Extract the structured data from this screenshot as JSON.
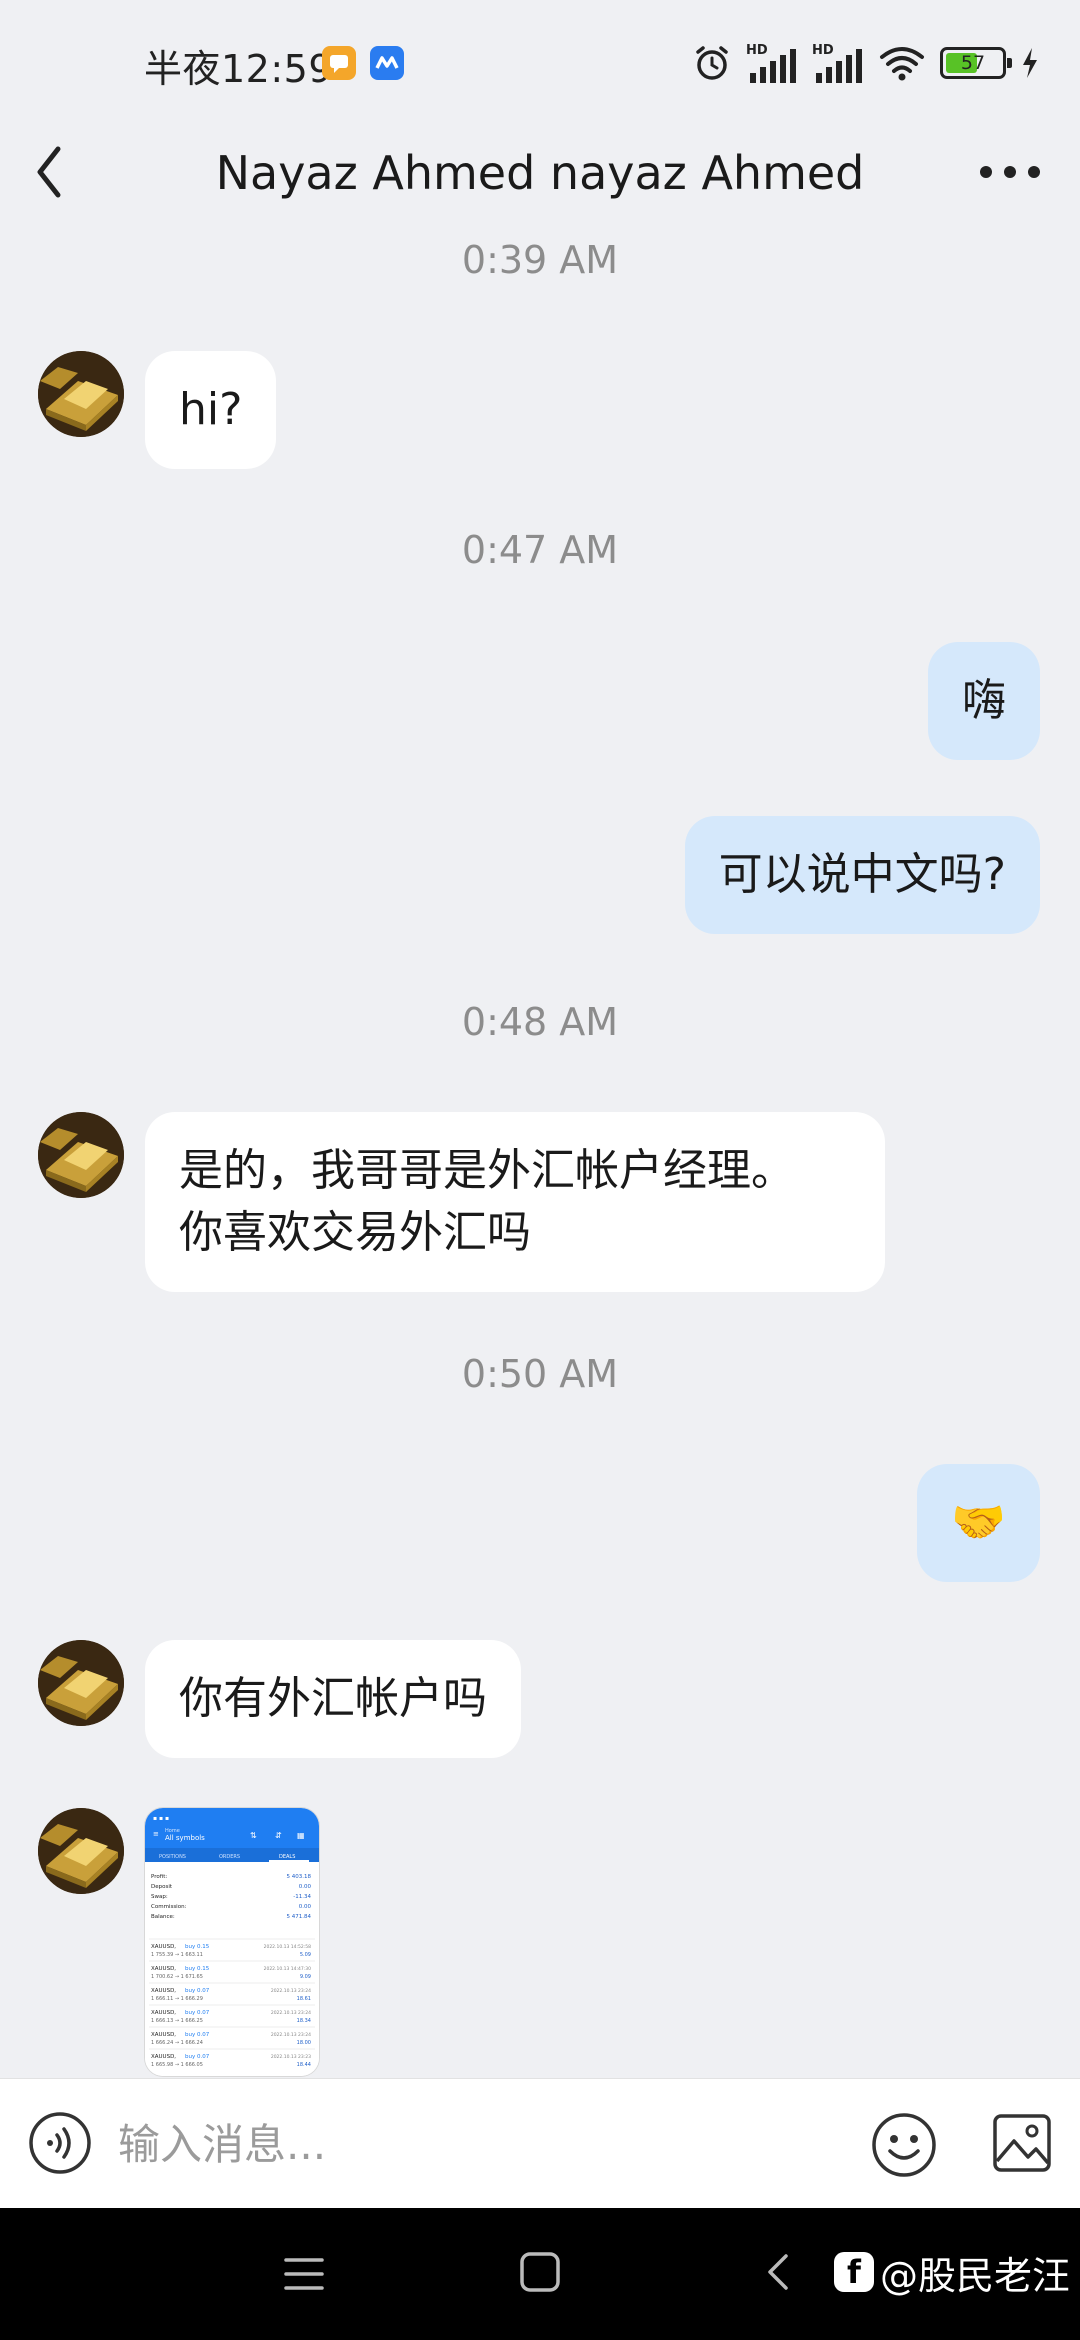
{
  "status_bar": {
    "time": "半夜12:59",
    "battery": "57",
    "signal_labels": [
      "HD",
      "HD"
    ]
  },
  "header": {
    "title": "Nayaz Ahmed nayaz Ahmed"
  },
  "messages": {
    "ts1": "0:39 AM",
    "m1": "hi?",
    "ts2": "0:47 AM",
    "m2": "嗨",
    "m3": "可以说中文吗?",
    "ts3": "0:48 AM",
    "m4_line1": "是的，我哥哥是外汇帐户经理。",
    "m4_line2": "你喜欢交易外汇吗",
    "ts4": "0:50 AM",
    "m5": "🤝",
    "m6": "你有外汇帐户吗"
  },
  "shared_screenshot": {
    "header_small": "Home",
    "header_title": "All symbols",
    "tabs": [
      "POSITIONS",
      "ORDERS",
      "DEALS"
    ],
    "summary": [
      {
        "label": "Profit:",
        "value": "5 403.18"
      },
      {
        "label": "Deposit",
        "value": "0.00"
      },
      {
        "label": "Swap:",
        "value": "-11.34"
      },
      {
        "label": "Commission:",
        "value": "0.00"
      },
      {
        "label": "Balance:",
        "value": "5 471.84"
      }
    ],
    "deals": [
      {
        "symbol": "XAUUSD,",
        "action": "buy 0.15",
        "prices": "1 755.39 → 1 663.11",
        "date": "2022.10.13 14:52:58",
        "pl": "5.09"
      },
      {
        "symbol": "XAUUSD,",
        "action": "buy 0.15",
        "prices": "1 700.62 → 1 671.65",
        "date": "2022.10.13 14:47:30",
        "pl": "9.09"
      },
      {
        "symbol": "XAUUSD,",
        "action": "buy 0.07",
        "prices": "1 666.11 → 1 666.29",
        "date": "2022.10.13 23:24",
        "pl": "18.61"
      },
      {
        "symbol": "XAUUSD,",
        "action": "buy 0.07",
        "prices": "1 666.13 → 1 666.25",
        "date": "2022.10.13 23:24",
        "pl": "18.34"
      },
      {
        "symbol": "XAUUSD,",
        "action": "buy 0.07",
        "prices": "1 666.24 → 1 666.24",
        "date": "2022.10.13 23:24",
        "pl": "18.00"
      },
      {
        "symbol": "XAUUSD,",
        "action": "buy 0.07",
        "prices": "1 665.98 → 1 666.05",
        "date": "2022.10.13 23:23",
        "pl": "18.44"
      }
    ]
  },
  "input_bar": {
    "placeholder": "输入消息..."
  },
  "watermark": {
    "text": "@股民老汪"
  },
  "colors": {
    "background": "#eff0f3",
    "incoming_bubble": "#ffffff",
    "outgoing_bubble": "#d5e8fb",
    "timestamp": "#8c8c8c"
  }
}
